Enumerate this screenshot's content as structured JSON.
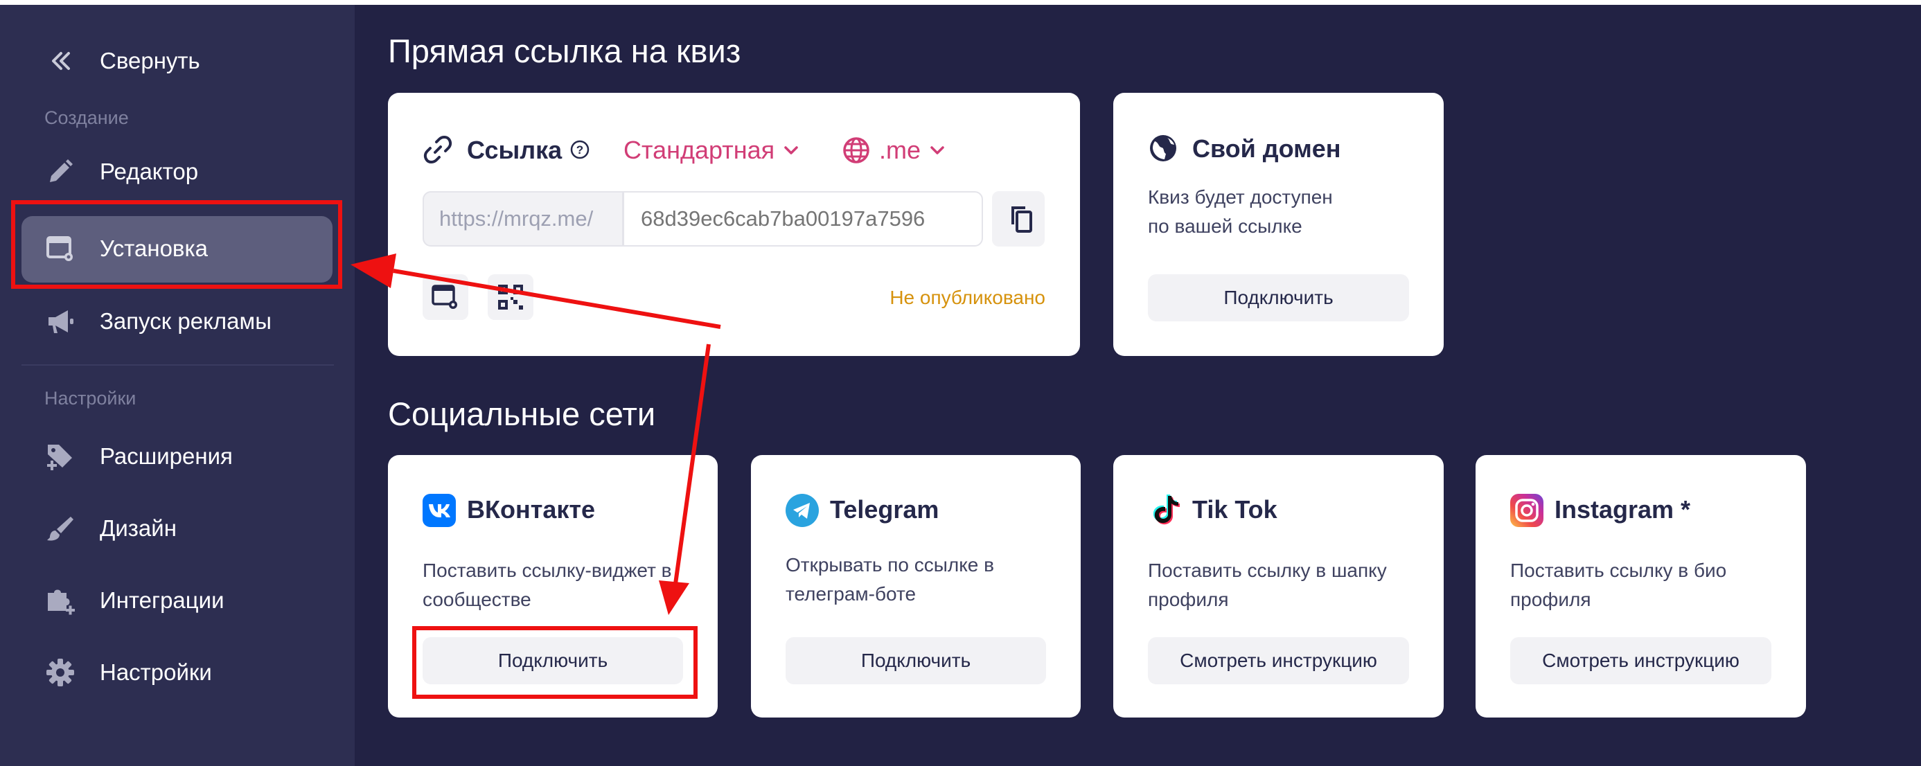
{
  "sidebar": {
    "collapse_label": "Свернуть",
    "section_create": "Создание",
    "section_settings": "Настройки",
    "items": [
      {
        "label": "Редактор",
        "icon": "pencil-icon"
      },
      {
        "label": "Установка",
        "icon": "install-window-icon",
        "active": true
      },
      {
        "label": "Запуск рекламы",
        "icon": "megaphone-icon"
      },
      {
        "label": "Расширения",
        "icon": "tag-plus-icon"
      },
      {
        "label": "Дизайн",
        "icon": "brush-icon"
      },
      {
        "label": "Интеграции",
        "icon": "puzzle-plus-icon"
      },
      {
        "label": "Настройки",
        "icon": "gear-icon"
      }
    ]
  },
  "direct_link": {
    "section_title": "Прямая ссылка на квиз",
    "link_label": "Ссылка",
    "type_select": "Стандартная",
    "domain_select": ".me",
    "url_prefix": "https://mrqz.me/",
    "url_id_placeholder": "68d39ec6cab7ba00197a7596",
    "status": "Не опубликовано"
  },
  "own_domain": {
    "title": "Свой домен",
    "desc_line1": "Квиз будет доступен",
    "desc_line2": "по вашей ссылке",
    "button": "Подключить"
  },
  "social": {
    "section_title": "Социальные сети",
    "cards": [
      {
        "title": "ВКонтакте",
        "desc_line1": "Поставить ссылку-виджет в",
        "desc_line2": "сообществе",
        "button": "Подключить"
      },
      {
        "title": "Telegram",
        "desc_line1": "Открывать по ссылке в",
        "desc_line2": "телеграм-боте",
        "button": "Подключить"
      },
      {
        "title": "Tik Tok",
        "desc_line1": "Поставить ссылку в шапку",
        "desc_line2": "профиля",
        "button": "Смотреть инструкцию"
      },
      {
        "title": "Instagram *",
        "desc_line1": "Поставить ссылку в био",
        "desc_line2": "профиля",
        "button": "Смотреть инструкцию"
      }
    ]
  },
  "colors": {
    "sidebar_bg": "#2d2e51",
    "main_bg": "#222244",
    "accent_pink": "#d13d76",
    "status_orange": "#d6920d",
    "annotation_red": "#ee1111"
  }
}
